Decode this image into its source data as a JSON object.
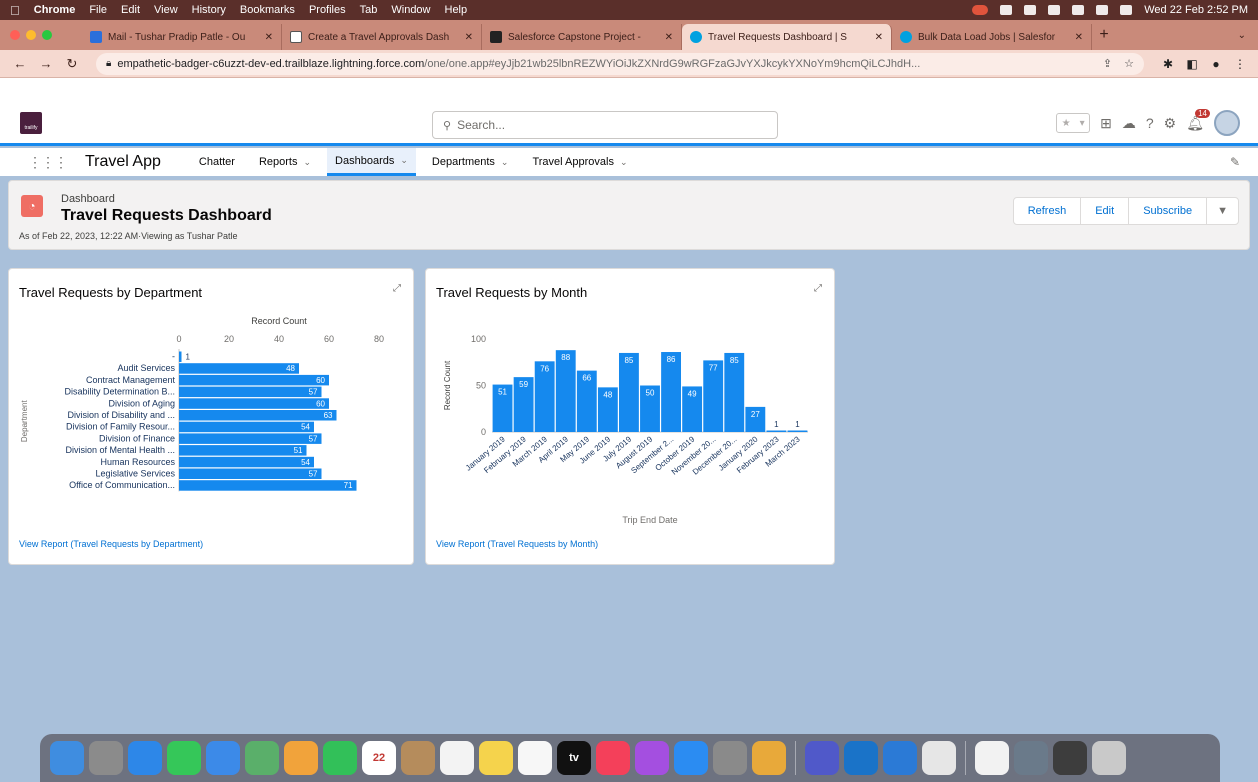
{
  "menubar": {
    "app": "Chrome",
    "items": [
      "File",
      "Edit",
      "View",
      "History",
      "Bookmarks",
      "Profiles",
      "Tab",
      "Window",
      "Help"
    ],
    "clock": "Wed 22 Feb  2:52 PM"
  },
  "tabs": [
    {
      "title": "Mail - Tushar Pradip Patle - Ou",
      "color": "#2a6fdb",
      "active": false
    },
    {
      "title": "Create a Travel Approvals Dash",
      "color": "#ffffff",
      "active": false
    },
    {
      "title": "Salesforce Capstone Project -",
      "color": "#222222",
      "active": false
    },
    {
      "title": "Travel Requests Dashboard | S",
      "color": "#00a1e0",
      "active": true
    },
    {
      "title": "Bulk Data Load Jobs | Salesfor",
      "color": "#00a1e0",
      "active": false
    }
  ],
  "address": {
    "host": "empathetic-badger-c6uzzt-dev-ed.trailblaze.lightning.force.com",
    "path": "/one/one.app#eyJjb21wb25lbnREZWYiOiJkZXNrdG9wRGFzaGJvYXJkcykYXNoYm9hcmQiLCJhdH..."
  },
  "sf": {
    "logo_text": "trailify",
    "search_placeholder": "Search...",
    "notification_count": "14",
    "app_name": "Travel App",
    "nav": [
      {
        "label": "Chatter",
        "chev": false,
        "active": false
      },
      {
        "label": "Reports",
        "chev": true,
        "active": false
      },
      {
        "label": "Dashboards",
        "chev": true,
        "active": true
      },
      {
        "label": "Departments",
        "chev": true,
        "active": false
      },
      {
        "label": "Travel Approvals",
        "chev": true,
        "active": false
      }
    ]
  },
  "dashboard": {
    "label": "Dashboard",
    "title": "Travel Requests Dashboard",
    "subtitle": "As of Feb 22, 2023, 12:22 AM·Viewing as Tushar Patle",
    "buttons": {
      "refresh": "Refresh",
      "edit": "Edit",
      "subscribe": "Subscribe"
    }
  },
  "cards": {
    "dept": {
      "title": "Travel Requests by Department",
      "link": "View Report (Travel Requests by Department)"
    },
    "month": {
      "title": "Travel Requests by Month",
      "link": "View Report (Travel Requests by Month)"
    }
  },
  "chart_data": [
    {
      "type": "bar",
      "orientation": "horizontal",
      "title": "Travel Requests by Department",
      "xlabel": "Record Count",
      "ylabel": "Department",
      "xlim": [
        0,
        80
      ],
      "xticks": [
        0,
        20,
        40,
        60,
        80
      ],
      "categories": [
        "-",
        "Audit Services",
        "Contract Management",
        "Disability Determination B...",
        "Division of Aging",
        "Division of Disability and ...",
        "Division of Family Resour...",
        "Division of Finance",
        "Division of Mental Health ...",
        "Human Resources",
        "Legislative Services",
        "Office of Communication..."
      ],
      "values": [
        1,
        48,
        60,
        57,
        60,
        63,
        54,
        57,
        51,
        54,
        57,
        71
      ],
      "color": "#1589ee"
    },
    {
      "type": "bar",
      "title": "Travel Requests by Month",
      "xlabel": "Trip End Date",
      "ylabel": "Record Count",
      "ylim": [
        0,
        100
      ],
      "yticks": [
        0,
        50,
        100
      ],
      "categories": [
        "January 2019",
        "February 2019",
        "March 2019",
        "April 2019",
        "May 2019",
        "June 2019",
        "July 2019",
        "August 2019",
        "September 2...",
        "October 2019",
        "November 20...",
        "December 20...",
        "January 2020",
        "February 2023",
        "March 2023"
      ],
      "values": [
        51,
        59,
        76,
        88,
        66,
        48,
        85,
        50,
        86,
        49,
        77,
        85,
        27,
        1,
        1
      ],
      "color": "#1589ee"
    }
  ],
  "dock": [
    {
      "name": "finder",
      "color": "#3f8de0"
    },
    {
      "name": "launchpad",
      "color": "#8b8b8b"
    },
    {
      "name": "safari",
      "color": "#2d87e8"
    },
    {
      "name": "messages",
      "color": "#35c759"
    },
    {
      "name": "mail",
      "color": "#3c8ae8"
    },
    {
      "name": "maps",
      "color": "#5aaf6a"
    },
    {
      "name": "photos",
      "color": "#f1a33b"
    },
    {
      "name": "facetime",
      "color": "#32c059"
    },
    {
      "name": "calendar",
      "color": "#ffffff",
      "label": "22"
    },
    {
      "name": "contacts",
      "color": "#b58c5c"
    },
    {
      "name": "reminders",
      "color": "#f3f3f3"
    },
    {
      "name": "notes",
      "color": "#f5d34c"
    },
    {
      "name": "freeform",
      "color": "#f7f7f7"
    },
    {
      "name": "tv",
      "color": "#111111",
      "label": "tv"
    },
    {
      "name": "music",
      "color": "#f4405a"
    },
    {
      "name": "podcasts",
      "color": "#a44fe0"
    },
    {
      "name": "app-store",
      "color": "#2b8cf2"
    },
    {
      "name": "system-settings",
      "color": "#8a8a8a"
    },
    {
      "name": "chrome",
      "color": "#e8a93a"
    },
    {
      "name": "teams",
      "color": "#5059c9"
    },
    {
      "name": "outlook",
      "color": "#1a73c8"
    },
    {
      "name": "vscode",
      "color": "#2b7ad6"
    },
    {
      "name": "textedit",
      "color": "#e6e6e6"
    },
    {
      "name": "document",
      "color": "#f2f2f2"
    },
    {
      "name": "downloads",
      "color": "#6a7a8a"
    },
    {
      "name": "screenshots",
      "color": "#3d3d3d"
    },
    {
      "name": "trash",
      "color": "#c9c9c9"
    }
  ]
}
